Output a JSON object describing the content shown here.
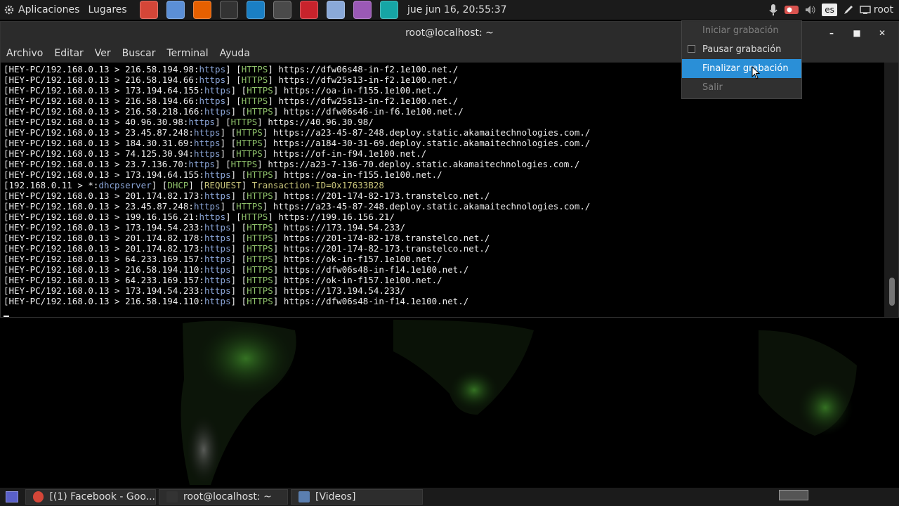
{
  "top_panel": {
    "applications_label": "Aplicaciones",
    "places_label": "Lugares",
    "launchers": [
      {
        "icon": "chrome-icon",
        "color": "#d44638"
      },
      {
        "icon": "chromium-icon",
        "color": "#5b8fd6"
      },
      {
        "icon": "firefox-icon",
        "color": "#e66000"
      },
      {
        "icon": "terminal-icon",
        "color": "#333333"
      },
      {
        "icon": "wireshark-icon",
        "color": "#1a7fc4"
      },
      {
        "icon": "sublime-icon",
        "color": "#4a4a4a"
      },
      {
        "icon": "tool-icon",
        "color": "#c8232c"
      },
      {
        "icon": "player-icon",
        "color": "#8aa9d8"
      },
      {
        "icon": "screenshot-icon",
        "color": "#9b59b6"
      },
      {
        "icon": "monitor-icon",
        "color": "#16a5a5"
      }
    ],
    "clock": "jue jun 16, 20:55:37",
    "language": "es",
    "user": "root"
  },
  "window": {
    "title": "root@localhost: ~",
    "menu": [
      "Archivo",
      "Editar",
      "Ver",
      "Buscar",
      "Terminal",
      "Ayuda"
    ]
  },
  "terminal_lines": [
    {
      "src": "[HEY-PC/192.168.0.13 > ",
      "host": "216.58.194.98",
      "port": "https",
      "proto": "HTTPS",
      "url": "https://dfw06s48-in-f2.1e100.net./"
    },
    {
      "src": "[HEY-PC/192.168.0.13 > ",
      "host": "216.58.194.66",
      "port": "https",
      "proto": "HTTPS",
      "url": "https://dfw25s13-in-f2.1e100.net./"
    },
    {
      "src": "[HEY-PC/192.168.0.13 > ",
      "host": "173.194.64.155",
      "port": "https",
      "proto": "HTTPS",
      "url": "https://oa-in-f155.1e100.net./"
    },
    {
      "src": "[HEY-PC/192.168.0.13 > ",
      "host": "216.58.194.66",
      "port": "https",
      "proto": "HTTPS",
      "url": "https://dfw25s13-in-f2.1e100.net./"
    },
    {
      "src": "[HEY-PC/192.168.0.13 > ",
      "host": "216.58.218.166",
      "port": "https",
      "proto": "HTTPS",
      "url": "https://dfw06s46-in-f6.1e100.net./"
    },
    {
      "src": "[HEY-PC/192.168.0.13 > ",
      "host": "40.96.30.98",
      "port": "https",
      "proto": "HTTPS",
      "url": "https://40.96.30.98/"
    },
    {
      "src": "[HEY-PC/192.168.0.13 > ",
      "host": "23.45.87.248",
      "port": "https",
      "proto": "HTTPS",
      "url": "https://a23-45-87-248.deploy.static.akamaitechnologies.com./"
    },
    {
      "src": "[HEY-PC/192.168.0.13 > ",
      "host": "184.30.31.69",
      "port": "https",
      "proto": "HTTPS",
      "url": "https://a184-30-31-69.deploy.static.akamaitechnologies.com./"
    },
    {
      "src": "[HEY-PC/192.168.0.13 > ",
      "host": "74.125.30.94",
      "port": "https",
      "proto": "HTTPS",
      "url": "https://of-in-f94.1e100.net./"
    },
    {
      "src": "[HEY-PC/192.168.0.13 > ",
      "host": "23.7.136.70",
      "port": "https",
      "proto": "HTTPS",
      "url": "https://a23-7-136-70.deploy.static.akamaitechnologies.com./"
    },
    {
      "src": "[HEY-PC/192.168.0.13 > ",
      "host": "173.194.64.155",
      "port": "https",
      "proto": "HTTPS",
      "url": "https://oa-in-f155.1e100.net./"
    },
    {
      "dhcp": true,
      "src": "[192.168.0.11 > *:",
      "host": "",
      "port": "dhcpserver",
      "proto": "DHCP",
      "kind": "REQUEST",
      "txid_label": "Transaction-ID=",
      "txid": "0x17633B28"
    },
    {
      "src": "[HEY-PC/192.168.0.13 > ",
      "host": "201.174.82.173",
      "port": "https",
      "proto": "HTTPS",
      "url": "https://201-174-82-173.transtelco.net./"
    },
    {
      "src": "[HEY-PC/192.168.0.13 > ",
      "host": "23.45.87.248",
      "port": "https",
      "proto": "HTTPS",
      "url": "https://a23-45-87-248.deploy.static.akamaitechnologies.com./"
    },
    {
      "src": "[HEY-PC/192.168.0.13 > ",
      "host": "199.16.156.21",
      "port": "https",
      "proto": "HTTPS",
      "url": "https://199.16.156.21/"
    },
    {
      "src": "[HEY-PC/192.168.0.13 > ",
      "host": "173.194.54.233",
      "port": "https",
      "proto": "HTTPS",
      "url": "https://173.194.54.233/"
    },
    {
      "src": "[HEY-PC/192.168.0.13 > ",
      "host": "201.174.82.178",
      "port": "https",
      "proto": "HTTPS",
      "url": "https://201-174-82-178.transtelco.net./"
    },
    {
      "src": "[HEY-PC/192.168.0.13 > ",
      "host": "201.174.82.173",
      "port": "https",
      "proto": "HTTPS",
      "url": "https://201-174-82-173.transtelco.net./"
    },
    {
      "src": "[HEY-PC/192.168.0.13 > ",
      "host": "64.233.169.157",
      "port": "https",
      "proto": "HTTPS",
      "url": "https://ok-in-f157.1e100.net./"
    },
    {
      "src": "[HEY-PC/192.168.0.13 > ",
      "host": "216.58.194.110",
      "port": "https",
      "proto": "HTTPS",
      "url": "https://dfw06s48-in-f14.1e100.net./"
    },
    {
      "src": "[HEY-PC/192.168.0.13 > ",
      "host": "64.233.169.157",
      "port": "https",
      "proto": "HTTPS",
      "url": "https://ok-in-f157.1e100.net./"
    },
    {
      "src": "[HEY-PC/192.168.0.13 > ",
      "host": "173.194.54.233",
      "port": "https",
      "proto": "HTTPS",
      "url": "https://173.194.54.233/"
    },
    {
      "src": "[HEY-PC/192.168.0.13 > ",
      "host": "216.58.194.110",
      "port": "https",
      "proto": "HTTPS",
      "url": "https://dfw06s48-in-f14.1e100.net./"
    }
  ],
  "popup_menu": {
    "items": [
      {
        "label": "Iniciar grabación",
        "state": "disabled"
      },
      {
        "label": "Pausar grabación",
        "state": "checkbox"
      },
      {
        "label": "Finalizar grabación",
        "state": "highlighted"
      },
      {
        "label": "Salir",
        "state": "disabled"
      }
    ]
  },
  "taskbar": {
    "tasks": [
      {
        "label": "[(1) Facebook - Goo...",
        "icon": "chrome-icon"
      },
      {
        "label": "root@localhost: ~",
        "icon": "terminal-icon"
      },
      {
        "label": "[Videos]",
        "icon": "folder-icon"
      }
    ]
  },
  "colors": {
    "highlight": "#2a8fd7",
    "panel": "#1b1b1b",
    "term_green": "#8ec16a",
    "term_blue": "#8aa4d6",
    "term_yellow": "#c7c37a"
  }
}
